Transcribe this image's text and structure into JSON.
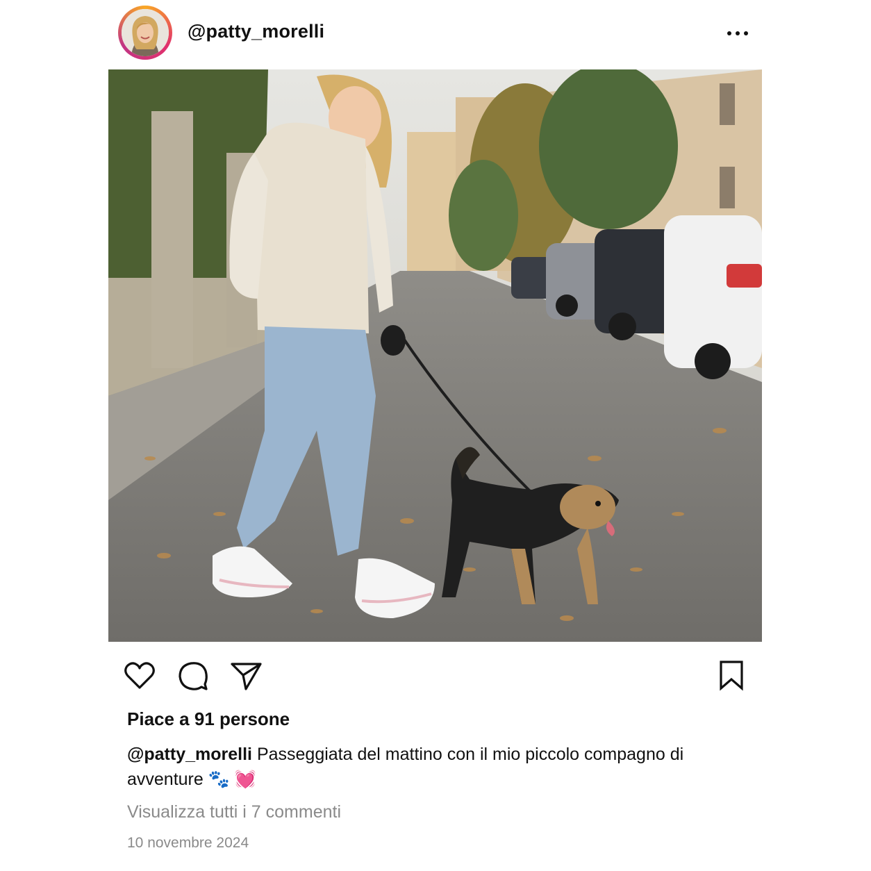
{
  "post": {
    "username": "@patty_morelli",
    "likes_text": "Piace a 91 persone",
    "caption_user": "@patty_morelli",
    "caption_text": "Passeggiata del mattino con il mio piccolo compagno di avventure 🐾 💓",
    "view_comments": "Visualizza tutti i 7 commenti",
    "date": "10 novembre 2024"
  },
  "icons": {
    "header": [
      "avatar",
      "more-options-icon"
    ],
    "actions": [
      "heart-icon",
      "comment-icon",
      "send-icon",
      "bookmark-icon"
    ]
  },
  "colors": {
    "text": "#111111",
    "muted": "#8a8a8a",
    "avatar_ring": [
      "#f9a825",
      "#e1306c",
      "#c13584"
    ]
  }
}
